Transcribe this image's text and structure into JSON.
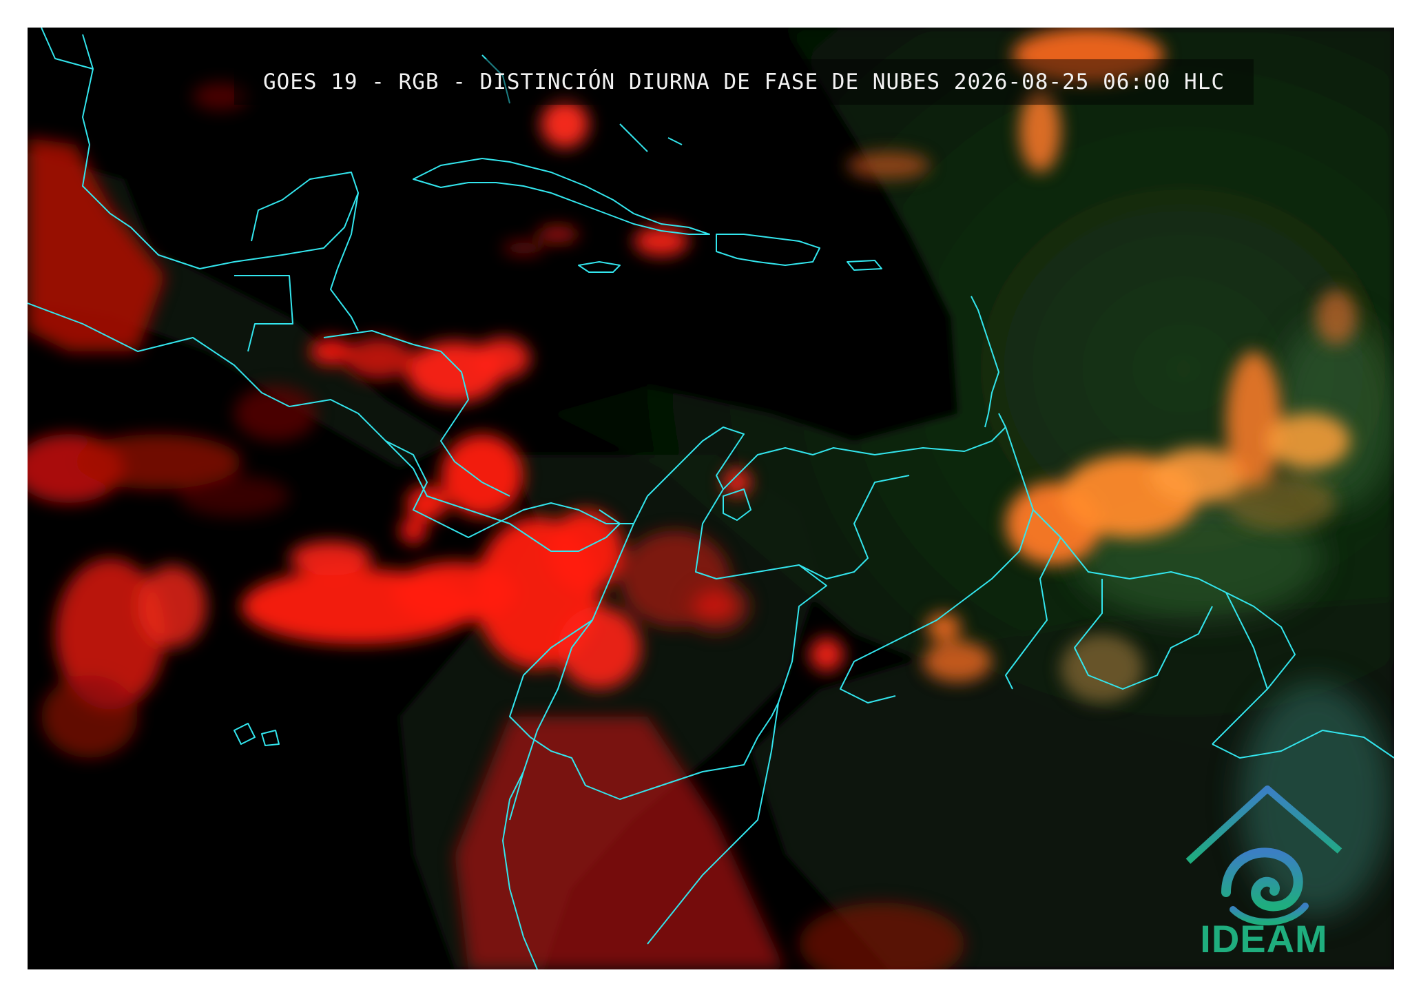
{
  "title": "GOES 19 - RGB - DISTINCIÓN DIURNA DE FASE DE NUBES 2026-08-25 06:00 HLC",
  "logo": {
    "text": "IDEAM",
    "icon": "ideam-swirl-mountain-icon"
  },
  "colors": {
    "coastline": "#33e6ee",
    "ice_cloud": "#ff1a10",
    "water_cloud": "#ff8a2a",
    "land": "#0c2a0c",
    "ocean": "#000000",
    "logo_blue": "#3b7fc4",
    "logo_green": "#1fae7e"
  }
}
